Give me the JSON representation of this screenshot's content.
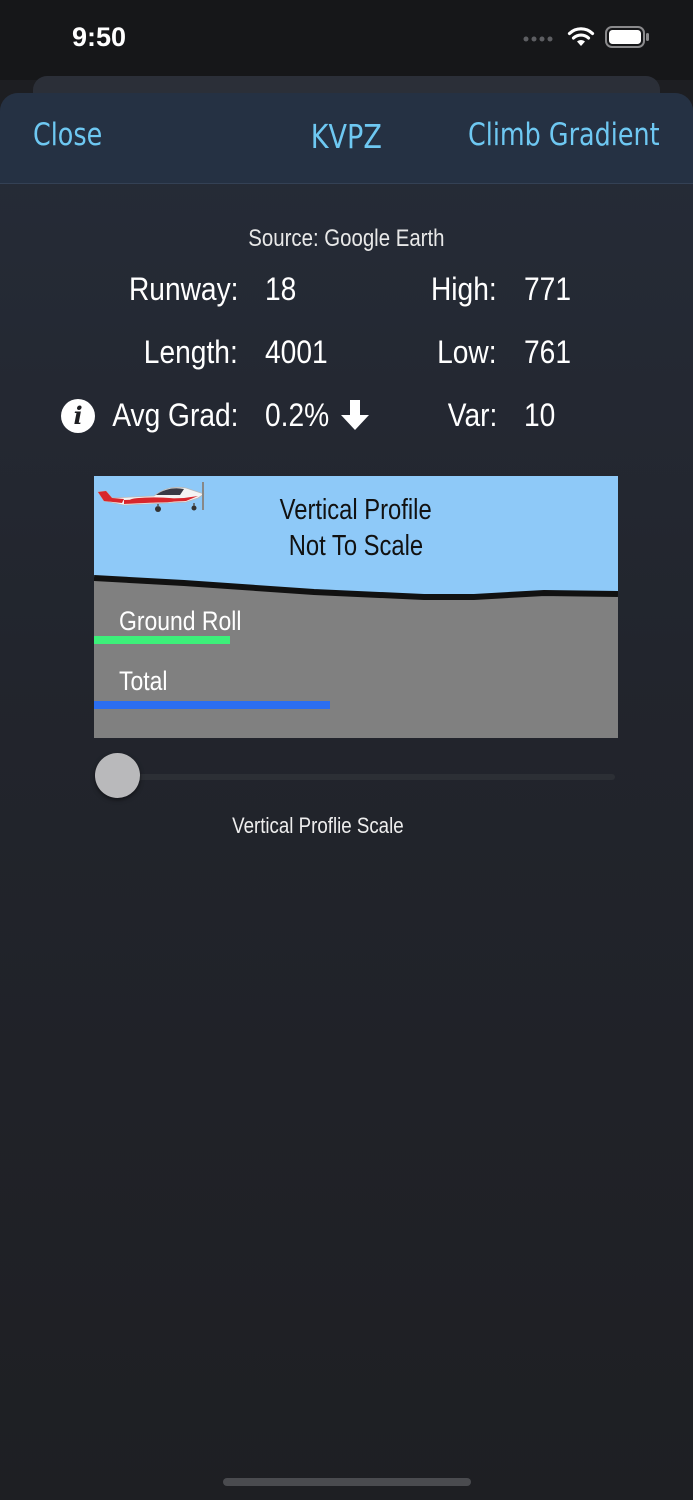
{
  "status_bar": {
    "time": "9:50"
  },
  "nav": {
    "close_label": "Close",
    "title": "KVPZ",
    "right_label": "Climb Gradient"
  },
  "source": "Source: Google Earth",
  "runway_info": {
    "runway_label": "Runway:",
    "runway_value": "18",
    "high_label": "High:",
    "high_value": "771",
    "length_label": "Length:",
    "length_value": "4001",
    "low_label": "Low:",
    "low_value": "761",
    "avg_grad_label": "Avg Grad:",
    "avg_grad_value": "0.2%",
    "var_label": "Var:",
    "var_value": "10",
    "gradient_direction_icon": "arrow-down-icon"
  },
  "profile": {
    "title_line1": "Vertical Profile",
    "title_line2": "Not To Scale",
    "ground_roll_label": "Ground Roll",
    "total_label": "Total",
    "ground_roll_fraction": 0.26,
    "total_fraction": 0.45,
    "colors": {
      "sky": "#8ec9f8",
      "ground": "#808080",
      "ground_roll": "#3df07a",
      "total": "#2b6ef0"
    }
  },
  "slider": {
    "label": "Vertical Proflie Scale",
    "value": 0
  },
  "colors": {
    "accent": "#6ec8f2"
  }
}
